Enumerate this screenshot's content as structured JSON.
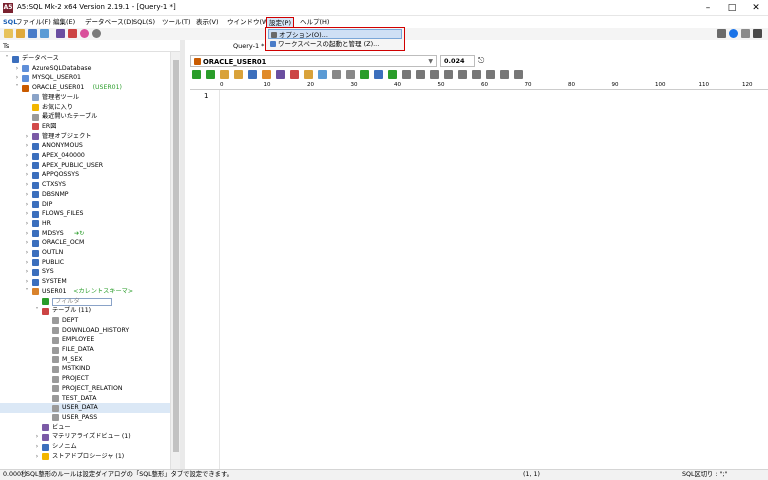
{
  "window": {
    "title": "A5:SQL Mk-2 x64 Version 2.19.1 - [Query-1 *]"
  },
  "menu": {
    "logo": "SQL",
    "items": [
      {
        "label": "ファイル(F)"
      },
      {
        "label": "編集(E)"
      },
      {
        "label": "データベース(D)"
      },
      {
        "label": "SQL(S)"
      },
      {
        "label": "ツール(T)"
      },
      {
        "label": "表示(V)"
      },
      {
        "label": "ウインドウ(W)"
      },
      {
        "label": "設定(P)"
      },
      {
        "label": "ヘルプ(H)"
      }
    ]
  },
  "settings_menu": {
    "options_label": "オプション(O)...",
    "workspace_label": "ワークスペースの起動と管理 (Z)..."
  },
  "sidebar": {
    "header": "Ts"
  },
  "tree": [
    {
      "depth": 0,
      "twisty": "v",
      "icon": "#3c6fbd",
      "label": "データベース"
    },
    {
      "depth": 1,
      "twisty": ">",
      "icon": "#5f8fd8",
      "label": "AzureSQLDatabase"
    },
    {
      "depth": 1,
      "twisty": ">",
      "icon": "#5f8fd8",
      "label": "MYSQL_USER01"
    },
    {
      "depth": 1,
      "twisty": "v",
      "icon": "#c95b00",
      "label": "ORACLE_USER01",
      "extra": "(USER01)",
      "extra_color": "#2a9d2a"
    },
    {
      "depth": 2,
      "twisty": "",
      "icon": "#8aa3c8",
      "label": "管理者ツール"
    },
    {
      "depth": 2,
      "twisty": "",
      "icon": "#f2b600",
      "label": "お気に入り"
    },
    {
      "depth": 2,
      "twisty": "",
      "icon": "#9a9a9a",
      "label": "最近開いたテーブル"
    },
    {
      "depth": 2,
      "twisty": "",
      "icon": "#d24a4a",
      "label": "ER図"
    },
    {
      "depth": 2,
      "twisty": ">",
      "icon": "#7b5aa6",
      "label": "管理オブジェクト"
    },
    {
      "depth": 2,
      "twisty": ">",
      "icon": "#3c6fbd",
      "label": "ANONYMOUS"
    },
    {
      "depth": 2,
      "twisty": ">",
      "icon": "#3c6fbd",
      "label": "APEX_040000"
    },
    {
      "depth": 2,
      "twisty": ">",
      "icon": "#3c6fbd",
      "label": "APEX_PUBLIC_USER"
    },
    {
      "depth": 2,
      "twisty": ">",
      "icon": "#3c6fbd",
      "label": "APPQOSSYS"
    },
    {
      "depth": 2,
      "twisty": ">",
      "icon": "#3c6fbd",
      "label": "CTXSYS"
    },
    {
      "depth": 2,
      "twisty": ">",
      "icon": "#3c6fbd",
      "label": "DBSNMP"
    },
    {
      "depth": 2,
      "twisty": ">",
      "icon": "#3c6fbd",
      "label": "DIP"
    },
    {
      "depth": 2,
      "twisty": ">",
      "icon": "#3c6fbd",
      "label": "FLOWS_FILES"
    },
    {
      "depth": 2,
      "twisty": ">",
      "icon": "#3c6fbd",
      "label": "HR"
    },
    {
      "depth": 2,
      "twisty": ">",
      "icon": "#3c6fbd",
      "label": "MDSYS",
      "arrows": true
    },
    {
      "depth": 2,
      "twisty": ">",
      "icon": "#3c6fbd",
      "label": "ORACLE_OCM"
    },
    {
      "depth": 2,
      "twisty": ">",
      "icon": "#3c6fbd",
      "label": "OUTLN"
    },
    {
      "depth": 2,
      "twisty": ">",
      "icon": "#3c6fbd",
      "label": "PUBLIC"
    },
    {
      "depth": 2,
      "twisty": ">",
      "icon": "#3c6fbd",
      "label": "SYS"
    },
    {
      "depth": 2,
      "twisty": ">",
      "icon": "#3c6fbd",
      "label": "SYSTEM"
    },
    {
      "depth": 2,
      "twisty": "v",
      "icon": "#d9822b",
      "label": "USER01",
      "extra": "<カレントスキーマ>",
      "extra_color": "#2a9d2a"
    },
    {
      "depth": 3,
      "twisty": "",
      "icon": "#2a9d2a",
      "label": "フィルタ",
      "filter": true
    },
    {
      "depth": 3,
      "twisty": "v",
      "icon": "#c44",
      "label": "テーブル (11)"
    },
    {
      "depth": 4,
      "twisty": "",
      "icon": "#9a9a9a",
      "label": "DEPT"
    },
    {
      "depth": 4,
      "twisty": "",
      "icon": "#9a9a9a",
      "label": "DOWNLOAD_HISTORY"
    },
    {
      "depth": 4,
      "twisty": "",
      "icon": "#9a9a9a",
      "label": "EMPLOYEE"
    },
    {
      "depth": 4,
      "twisty": "",
      "icon": "#9a9a9a",
      "label": "FILE_DATA"
    },
    {
      "depth": 4,
      "twisty": "",
      "icon": "#9a9a9a",
      "label": "M_SEX"
    },
    {
      "depth": 4,
      "twisty": "",
      "icon": "#9a9a9a",
      "label": "MSTKIND"
    },
    {
      "depth": 4,
      "twisty": "",
      "icon": "#9a9a9a",
      "label": "PROJECT"
    },
    {
      "depth": 4,
      "twisty": "",
      "icon": "#9a9a9a",
      "label": "PROJECT_RELATION"
    },
    {
      "depth": 4,
      "twisty": "",
      "icon": "#9a9a9a",
      "label": "TEST_DATA"
    },
    {
      "depth": 4,
      "twisty": "",
      "icon": "#9a9a9a",
      "label": "USER_DATA",
      "selected": true
    },
    {
      "depth": 4,
      "twisty": "",
      "icon": "#9a9a9a",
      "label": "USER_PASS"
    },
    {
      "depth": 3,
      "twisty": "",
      "icon": "#7b5aa6",
      "label": "ビュー"
    },
    {
      "depth": 3,
      "twisty": ">",
      "icon": "#7b5aa6",
      "label": "マテリアライズドビュー (1)"
    },
    {
      "depth": 3,
      "twisty": ">",
      "icon": "#3c6fbd",
      "label": "シノニム"
    },
    {
      "depth": 3,
      "twisty": ">",
      "icon": "#f2b600",
      "label": "ストアドプロシージャ (1)"
    }
  ],
  "query": {
    "tab_label": "Query-1 *",
    "connection": "ORACLE_USER01",
    "elapsed": "0.024",
    "line_number": "1",
    "ruler": [
      "0",
      "10",
      "20",
      "30",
      "40",
      "50",
      "60",
      "70",
      "80",
      "90",
      "100",
      "110",
      "120"
    ]
  },
  "status": {
    "time": "0.000秒",
    "message": "SQL整形のルールは設定ダイアログの「SQL整形」タブで設定できます。",
    "position": "(1, 1)",
    "delimiter": "SQL区切り : \";\""
  }
}
